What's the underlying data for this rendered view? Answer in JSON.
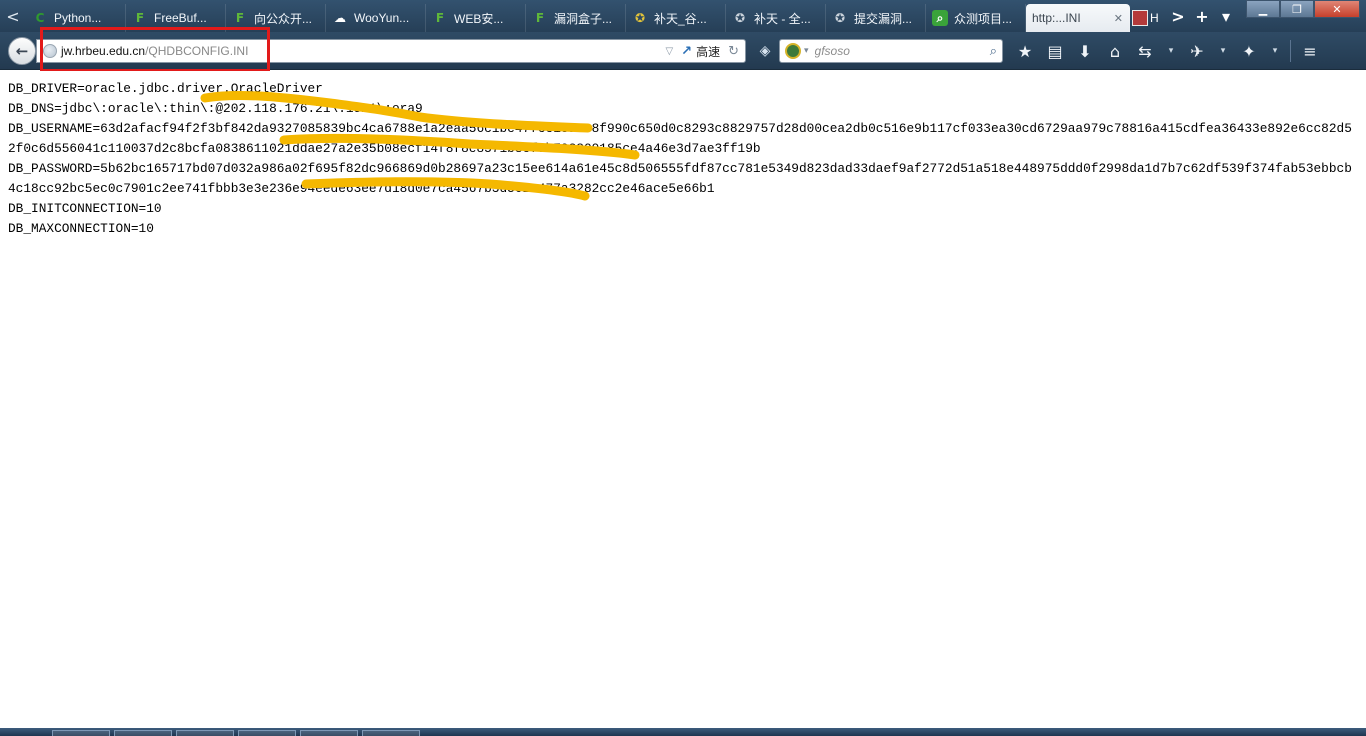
{
  "tabs": [
    {
      "label": "Python...",
      "icon": "C",
      "icon_color": "#2f9a2f",
      "icon_bg": "transparent"
    },
    {
      "label": "FreeBuf...",
      "icon": "F",
      "icon_color": "#5fb83a",
      "icon_bg": "transparent"
    },
    {
      "label": "向公众开...",
      "icon": "F",
      "icon_color": "#5fb83a",
      "icon_bg": "transparent"
    },
    {
      "label": "WooYun...",
      "icon": "☁",
      "icon_color": "#ffffff",
      "icon_bg": "transparent"
    },
    {
      "label": "WEB安...",
      "icon": "F",
      "icon_color": "#5fb83a",
      "icon_bg": "transparent"
    },
    {
      "label": "漏洞盒子...",
      "icon": "F",
      "icon_color": "#5fb83a",
      "icon_bg": "transparent"
    },
    {
      "label": "补天_谷...",
      "icon": "✪",
      "icon_color": "#e0c23a",
      "icon_bg": "transparent"
    },
    {
      "label": "补天 - 全...",
      "icon": "✪",
      "icon_color": "#c9d2db",
      "icon_bg": "transparent"
    },
    {
      "label": "提交漏洞...",
      "icon": "✪",
      "icon_color": "#c9d2db",
      "icon_bg": "transparent"
    },
    {
      "label": "众测项目...",
      "icon": "⌕",
      "icon_color": "#ffffff",
      "icon_bg": "#3aa33a"
    }
  ],
  "active_tab": {
    "label": "http:...INI",
    "close": "✕"
  },
  "tail_tab": {
    "label": "H"
  },
  "strip": {
    "scroll_left": "<",
    "scroll_right": ">",
    "new_tab": "+",
    "list": "▾"
  },
  "window": {
    "minimize": "▁",
    "restore": "❐",
    "close": "✕"
  },
  "nav": {
    "back_icon": "←",
    "url_domain": "jw.hrbeu.edu.cn",
    "url_path": "/QHDBCONFIG.INI",
    "dropdown_icon": "▽",
    "accel_icon": "↗",
    "speed_label": "高速",
    "reload_icon": "↻"
  },
  "search": {
    "placeholder": "gfsoso",
    "drop_icon": "▾",
    "search_icon": "⌕"
  },
  "toolbar": {
    "star": "★",
    "bookmarks": "▤",
    "download": "⬇",
    "home": "⌂",
    "sync": "⇆",
    "drop1": "▾",
    "addon1": "✈",
    "drop2": "▾",
    "addon2": "✦",
    "drop3": "▾",
    "menu": "≡"
  },
  "file_text": "DB_DRIVER=oracle.jdbc.driver.OracleDriver\nDB_DNS=jdbc\\:oracle\\:thin\\:@202.118.176.21\\:1521\\:ora9\nDB_USERNAME=63d2afacf94f2f3bf842da9327085839bc4ca6788e1a2eaa56c1be47fce18a5e8f990c650d0c8293c8829757d28d00cea2db0c516e9b117cf033ea30cd6729aa979c78816a415cdfea36433e892e6cc82d52f0c6d556041c110037d2c8bcfa0838611021ddae27a2e35b08ecf14f8f8e8571b8ef8b798809185ce4a46e3d7ae3ff19b\nDB_PASSWORD=5b62bc165717bd07d032a986a02f695f82dc966869d0b28697a23c15ee614a61e45c8d506555fdf87cc781e5349d823dad33daef9af2772d51a518e448975ddd0f2998da1d7b7c62df539f374fab53ebbcb4c18cc92bc5ec0c7901c2ee741fbbb3e3e236e94eede63ee7d18d0e7ca4567b3d501e477a3282cc2e46ace5e66b1\nDB_INITCONNECTION=10\nDB_MAXCONNECTION=10",
  "colors": {
    "highlight": "#e21a1a",
    "scribble": "#f5b800"
  }
}
